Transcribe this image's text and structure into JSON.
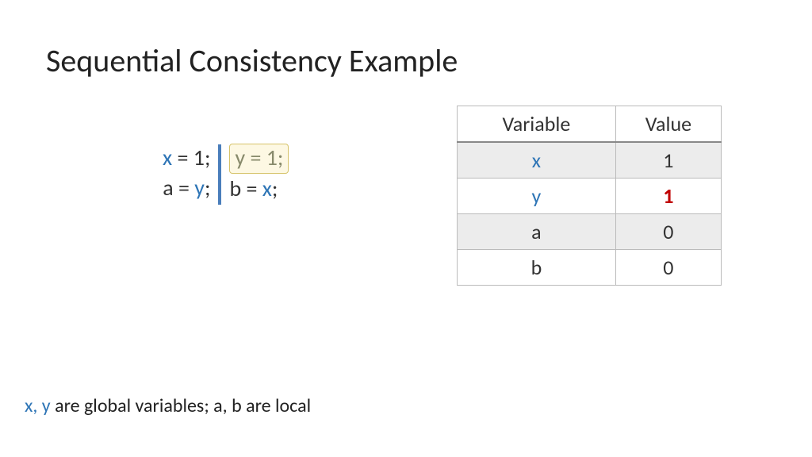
{
  "title": "Sequential Consistency Example",
  "code": {
    "thread1": {
      "line1": {
        "var": "x",
        "rest": " = 1;"
      },
      "line2": {
        "lhs": "a = ",
        "rhs": "y",
        "tail": ";"
      }
    },
    "thread2": {
      "line1": {
        "var": "y",
        "rest": " = 1;"
      },
      "line2": {
        "lhs": "b = ",
        "rhs": "x",
        "tail": ";"
      }
    }
  },
  "table": {
    "headers": {
      "col1": "Variable",
      "col2": "Value"
    },
    "rows": [
      {
        "var": "x",
        "val": "1",
        "var_blue": true,
        "val_emph": false
      },
      {
        "var": "y",
        "val": "1",
        "var_blue": true,
        "val_emph": true
      },
      {
        "var": "a",
        "val": "0",
        "var_blue": false,
        "val_emph": false
      },
      {
        "var": "b",
        "val": "0",
        "var_blue": false,
        "val_emph": false
      }
    ]
  },
  "footnote": {
    "p1": "x, y",
    "p2": " are global variables; a, b are local"
  }
}
